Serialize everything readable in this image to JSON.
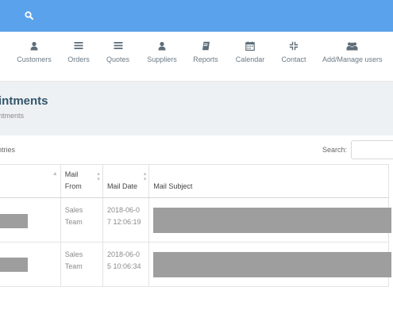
{
  "topbar": {
    "search_icon": "search-icon"
  },
  "nav": {
    "items": [
      {
        "label": "Customers",
        "icon": "user-icon"
      },
      {
        "label": "Orders",
        "icon": "list-icon"
      },
      {
        "label": "Quotes",
        "icon": "list-icon"
      },
      {
        "label": "Suppliers",
        "icon": "user-icon"
      },
      {
        "label": "Reports",
        "icon": "book-icon"
      },
      {
        "label": "Calendar",
        "icon": "calendar-icon"
      },
      {
        "label": "Contact",
        "icon": "compress-icon"
      },
      {
        "label": "Add/Manage users",
        "icon": "users-icon"
      }
    ]
  },
  "header": {
    "title": "intments",
    "subtitle": "ntments"
  },
  "table_controls": {
    "entries_text": "ntries",
    "search_label": "Search:",
    "search_value": "",
    "search_placeholder": ""
  },
  "table": {
    "columns": [
      "",
      "Mail From",
      "Mail Date",
      "Mail Subject"
    ],
    "rows": [
      {
        "mail_from": "Sales Team",
        "mail_date": "2018-06-07 12:06:19"
      },
      {
        "mail_from": "Sales Team",
        "mail_date": "2018-06-05 10:06:34"
      }
    ]
  },
  "colors": {
    "topbar": "#5aa2eb",
    "header_band": "#eef1f3",
    "title": "#35556b",
    "redaction": "#9e9e9e"
  }
}
